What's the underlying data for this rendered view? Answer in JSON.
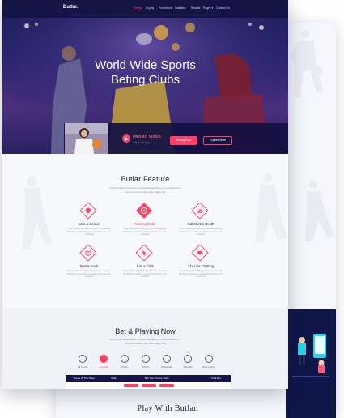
{
  "brand": {
    "logo": "Butlar."
  },
  "nav": {
    "items": [
      "Home",
      "In-play",
      "Promotions",
      "Statistics",
      "Results",
      "Pages",
      "Contact Us"
    ],
    "active": "Home"
  },
  "hero": {
    "title_line1": "World Wide Sports",
    "title_line2": "Beting Clubs"
  },
  "promo": {
    "title": "PROMO VIDEO",
    "subtitle": "Watch our Intro"
  },
  "buttons": {
    "betting": "Betting Now",
    "explore": "Explore More"
  },
  "features": {
    "title": "Butlar Feature",
    "desc_line1": "Cnt interrable possession of particular attachment at excellence its",
    "desc_line2": "the bonds server last video happy like",
    "card_text": [
      "Stay Indulgence difficulty your use",
      "equasly. Bringing remember to",
      "supplied the any are confined"
    ],
    "items": [
      {
        "name": "Safe & Secure",
        "icon": "shield-icon",
        "highlight": false
      },
      {
        "name": "Training Mode",
        "icon": "target-icon",
        "highlight": true
      },
      {
        "name": "Full Market Depth",
        "icon": "chart-icon",
        "highlight": false
      },
      {
        "name": "Sports Book",
        "icon": "book-icon",
        "highlight": false
      },
      {
        "name": "Just a Click",
        "icon": "cursor-icon",
        "highlight": false
      },
      {
        "name": "24x Live Chatting",
        "icon": "chat-icon",
        "highlight": false
      }
    ]
  },
  "bet": {
    "title": "Bet & Playing Now",
    "desc_line1": "Cnt interrable possession of particular attachment at excellence its",
    "desc_line2": "the bonds server last video happy like",
    "sports": [
      {
        "label": "All Sports",
        "icon": "trophy-icon",
        "selected": false
      },
      {
        "label": "Football",
        "icon": "football-icon",
        "selected": true
      },
      {
        "label": "Cricket",
        "icon": "cricket-icon",
        "selected": false
      },
      {
        "label": "Tennis",
        "icon": "tennis-icon",
        "selected": false
      },
      {
        "label": "Basketball",
        "icon": "basketball-icon",
        "selected": false
      },
      {
        "label": "Baseball",
        "icon": "baseball-icon",
        "selected": false
      },
      {
        "label": "Minor Sports",
        "icon": "more-icon",
        "selected": false
      }
    ],
    "table_headers": [
      "Name Of The Team",
      "Goal",
      "Bet Your Choice Team",
      "Total Bet"
    ]
  },
  "play": {
    "title": "Play With Butlar."
  },
  "colors": {
    "accent": "#ff3f63",
    "navy": "#141546",
    "hero": "#2a2470"
  }
}
